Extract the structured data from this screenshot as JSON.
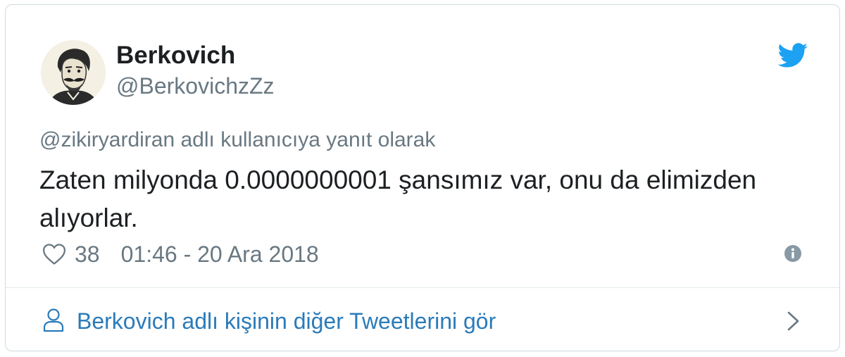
{
  "author": {
    "name": "Berkovich",
    "handle": "@BerkovichzZz"
  },
  "tweet": {
    "reply_context": "@zikiryardiran adlı kullanıcıya yanıt olarak",
    "text": "Zaten milyonda 0.0000000001 şansımız var, onu da elimizden alıyorlar.",
    "like_count": "38",
    "timestamp": "01:46 - 20 Ara 2018"
  },
  "footer": {
    "label": "Berkovich adlı kişinin diğer Tweetlerini gör"
  },
  "icons": {
    "logo": "twitter-bird-icon",
    "like": "heart-outline-icon",
    "info": "info-circle-icon",
    "footer_user": "user-outline-icon",
    "footer_chevron": "chevron-right-icon"
  },
  "colors": {
    "brand_blue": "#1da1f2",
    "link_blue": "#2b7bb9",
    "text_primary": "#1c2022",
    "text_secondary": "#697882",
    "border": "#cfd9de"
  }
}
